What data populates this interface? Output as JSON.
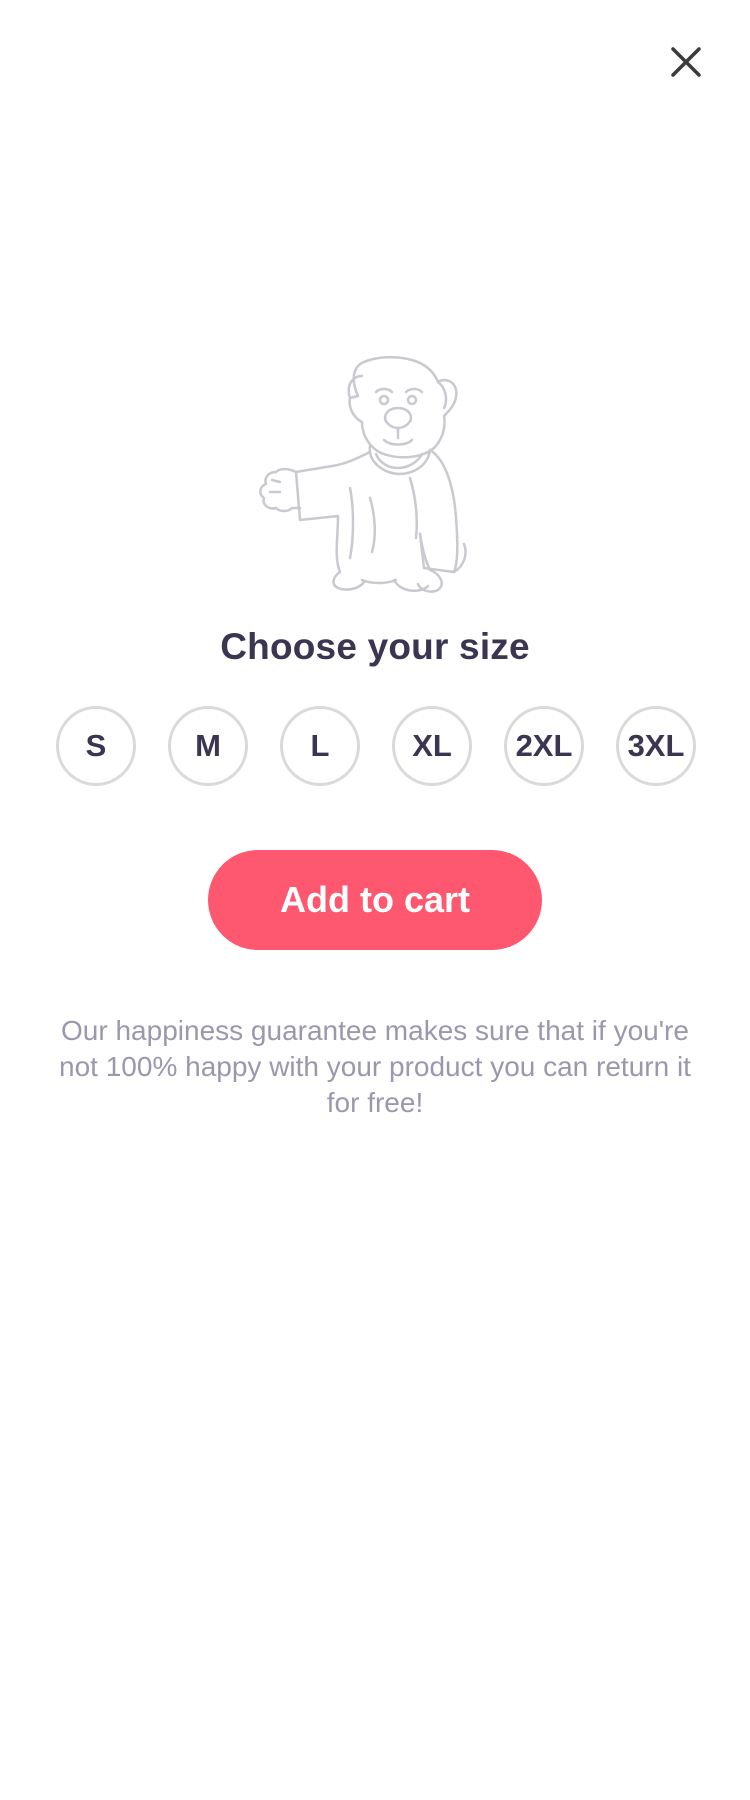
{
  "close": {
    "icon": "close-icon",
    "color": "#3b3b3b"
  },
  "illustration": {
    "icon": "pug-in-shirt-illustration",
    "stroke": "#c9c9cf"
  },
  "title": "Choose your size",
  "sizes": [
    {
      "label": "S"
    },
    {
      "label": "M"
    },
    {
      "label": "L"
    },
    {
      "label": "XL"
    },
    {
      "label": "2XL"
    },
    {
      "label": "3XL"
    }
  ],
  "add_to_cart": {
    "label": "Add to cart",
    "color": "#fd586f"
  },
  "guarantee_text": "Our happiness guarantee makes sure that if you're not 100% happy with your product you can return it for free!",
  "colors": {
    "title": "#3b3551",
    "body_text": "#9a98ac",
    "size_border": "#dadada"
  }
}
